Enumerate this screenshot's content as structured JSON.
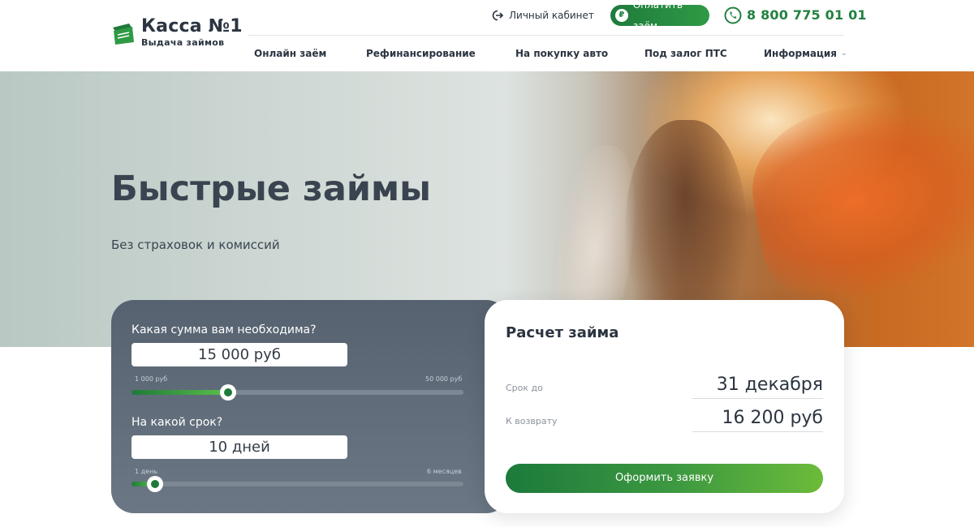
{
  "brand": {
    "title": "Касса №1",
    "subtitle": "Выдача займов",
    "colors": {
      "green": "#238140",
      "text": "#2b3440"
    }
  },
  "header": {
    "cabinet_label": "Личный кабинет",
    "cabinet_icon": "login-arrow-icon",
    "pay_label": "Оплатить заём",
    "pay_icon": "ruble-icon",
    "phone": "8 800 775 01 01",
    "phone_icon": "phone-icon"
  },
  "nav": {
    "items": [
      {
        "label": "Онлайн заём"
      },
      {
        "label": "Рефинансирование"
      },
      {
        "label": "На покупку авто"
      },
      {
        "label": "Под залог ПТС"
      },
      {
        "label": "Информация",
        "dropdown": true
      }
    ]
  },
  "hero": {
    "title": "Быстрые займы",
    "subtitle": "Без страховок и комиссий"
  },
  "calculator": {
    "amount": {
      "question": "Какая сумма вам необходима?",
      "value": "15 000 руб",
      "min_label": "1 000 руб",
      "max_label": "50 000 руб",
      "fill_fraction": 0.29
    },
    "term": {
      "question": "На какой срок?",
      "value": "10 дней",
      "min_label": "1 день",
      "max_label": "6 месяцев",
      "fill_fraction": 0.07
    }
  },
  "result": {
    "title": "Расчет займа",
    "due_label": "Срок до",
    "due_value": "31 декабря",
    "return_label": "К возврату",
    "return_value": "16 200 руб",
    "submit_label": "Оформить заявку"
  }
}
